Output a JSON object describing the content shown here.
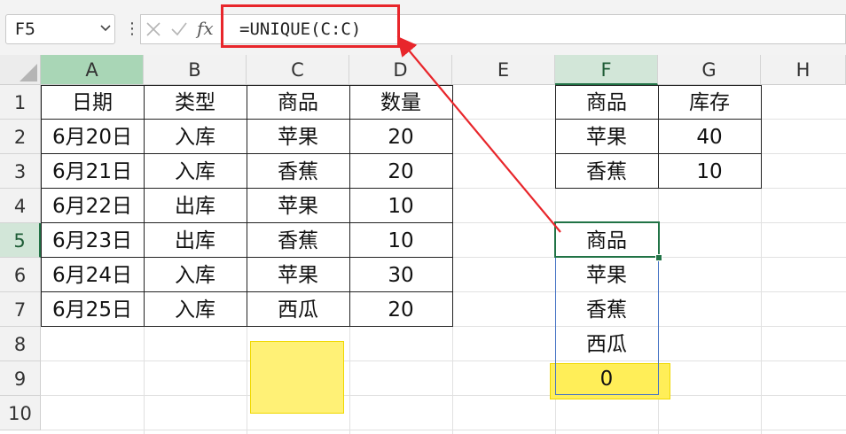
{
  "formula_bar": {
    "name_box": "F5",
    "fx_label": "fx",
    "formula": "=UNIQUE(C:C)"
  },
  "columns": [
    "A",
    "B",
    "C",
    "D",
    "E",
    "F",
    "G",
    "H"
  ],
  "rows": [
    "1",
    "2",
    "3",
    "4",
    "5",
    "6",
    "7",
    "8",
    "9",
    "10"
  ],
  "main_table": {
    "headers": [
      "日期",
      "类型",
      "商品",
      "数量"
    ],
    "rows": [
      [
        "6月20日",
        "入库",
        "苹果",
        "20"
      ],
      [
        "6月21日",
        "入库",
        "香蕉",
        "20"
      ],
      [
        "6月22日",
        "出库",
        "苹果",
        "10"
      ],
      [
        "6月23日",
        "出库",
        "香蕉",
        "10"
      ],
      [
        "6月24日",
        "入库",
        "苹果",
        "30"
      ],
      [
        "6月25日",
        "入库",
        "西瓜",
        "20"
      ]
    ]
  },
  "stock_table": {
    "headers": [
      "商品",
      "库存"
    ],
    "rows": [
      [
        "苹果",
        "40"
      ],
      [
        "香蕉",
        "10"
      ]
    ]
  },
  "unique_result": [
    "商品",
    "苹果",
    "香蕉",
    "西瓜",
    "0"
  ],
  "colors": {
    "highlight_red": "#e8262b",
    "selection_green": "#217346",
    "spill_blue": "#4472c4",
    "yellow_fill": "#fff176"
  }
}
